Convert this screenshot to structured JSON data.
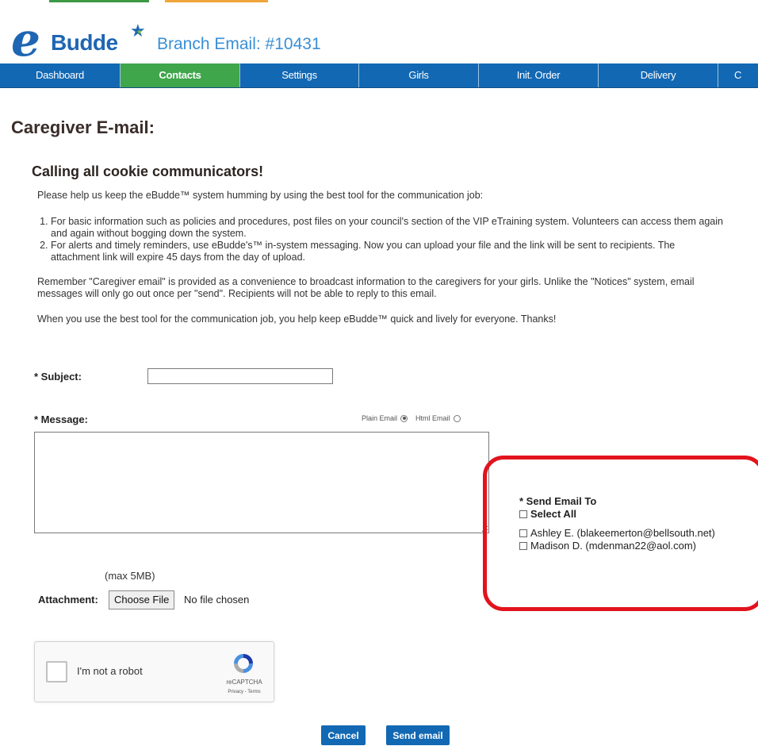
{
  "header": {
    "logo_e": "e",
    "logo_text": "Budde",
    "branch_title": "Branch Email: #10431"
  },
  "nav": {
    "items": [
      {
        "label": "Dashboard",
        "active": false
      },
      {
        "label": "Contacts",
        "active": true
      },
      {
        "label": "Settings",
        "active": false
      },
      {
        "label": "Girls",
        "active": false
      },
      {
        "label": "Init. Order",
        "active": false
      },
      {
        "label": "Delivery",
        "active": false
      },
      {
        "label": "C",
        "active": false
      }
    ]
  },
  "page": {
    "title": "Caregiver E-mail:",
    "section_title": "Calling all cookie communicators!",
    "intro": "Please help us keep the eBudde™ system humming by using the best tool for the communication job:",
    "list": [
      "For basic information such as policies and procedures, post files on your council's section of the VIP eTraining system. Volunteers can access them again and again without bogging down the system.",
      "For alerts and timely reminders, use eBudde's™ in-system messaging. Now you can upload your file and the link will be sent to recipients. The attachment link will expire 45 days from the day of upload."
    ],
    "note": "Remember \"Caregiver email\" is provided as a convenience to broadcast information to the caregivers for your girls. Unlike the \"Notices\" system, email messages will only go out once per \"send\". Recipients will not be able to reply to this email.",
    "note2": "When you use the best tool for the communication job, you help keep eBudde™ quick and lively for everyone. Thanks!"
  },
  "form": {
    "subject_label": "* Subject:",
    "subject_value": "",
    "message_label": "* Message:",
    "plain_email_label": "Plain Email",
    "html_email_label": "Html Email",
    "message_value": "",
    "max_size": "(max 5MB)",
    "attachment_label": "Attachment:",
    "choose_file_label": "Choose File",
    "no_file_text": "No file chosen"
  },
  "send_to": {
    "label": "* Send Email To",
    "select_all": "Select All",
    "recipients": [
      "Ashley E. (blakeemerton@bellsouth.net)",
      "Madison D. (mdenman22@aol.com)"
    ]
  },
  "captcha": {
    "text": "I'm not a robot",
    "brand": "reCAPTCHA",
    "links": "Privacy - Terms"
  },
  "actions": {
    "cancel": "Cancel",
    "send": "Send email"
  },
  "colors": {
    "nav_blue": "#1268b3",
    "nav_active_green": "#3fa64b",
    "highlight_red": "#e2131d"
  }
}
